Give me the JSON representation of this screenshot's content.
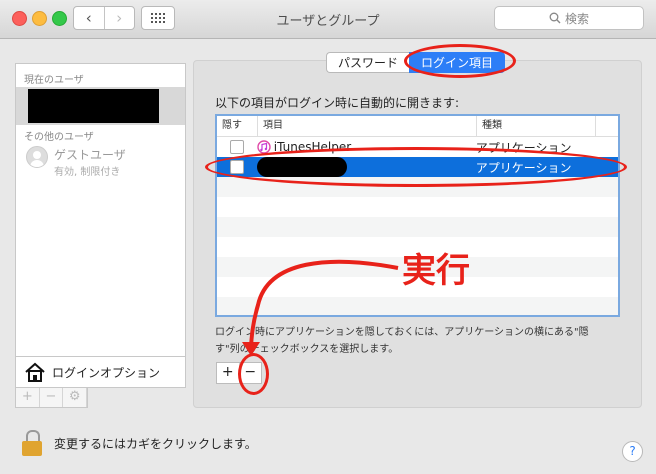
{
  "window": {
    "title": "ユーザとグループ"
  },
  "toolbar": {
    "back_glyph": "‹",
    "forward_glyph": "›",
    "search_placeholder": "検索"
  },
  "sidebar": {
    "current_users_header": "現在のユーザ",
    "other_users_header": "その他のユーザ",
    "guest_name": "ゲストユーザ",
    "guest_status": "有効, 制限付き",
    "login_options_label": "ログインオプション",
    "tools": [
      "+",
      "−",
      "⚙"
    ]
  },
  "tabs": {
    "password": "パスワード",
    "login_items": "ログイン項目"
  },
  "main": {
    "intro": "以下の項目がログイン時に自動的に開きます:",
    "columns": {
      "hide": "隠す",
      "item": "項目",
      "kind": "種類"
    },
    "rows": [
      {
        "name": "iTunesHelper",
        "kind": "アプリケーション"
      },
      {
        "name": "",
        "kind": "アプリケーション"
      }
    ],
    "note": "ログイン時にアプリケーションを隠しておくには、アプリケーションの横にある\"隠す\"列のチェックボックスを選択します。",
    "add_label": "+",
    "remove_label": "−"
  },
  "footer": {
    "lock_text": "変更するにはカギをクリックします。",
    "help_label": "?"
  },
  "annotation": {
    "label": "実行",
    "color": "#e8221a"
  }
}
